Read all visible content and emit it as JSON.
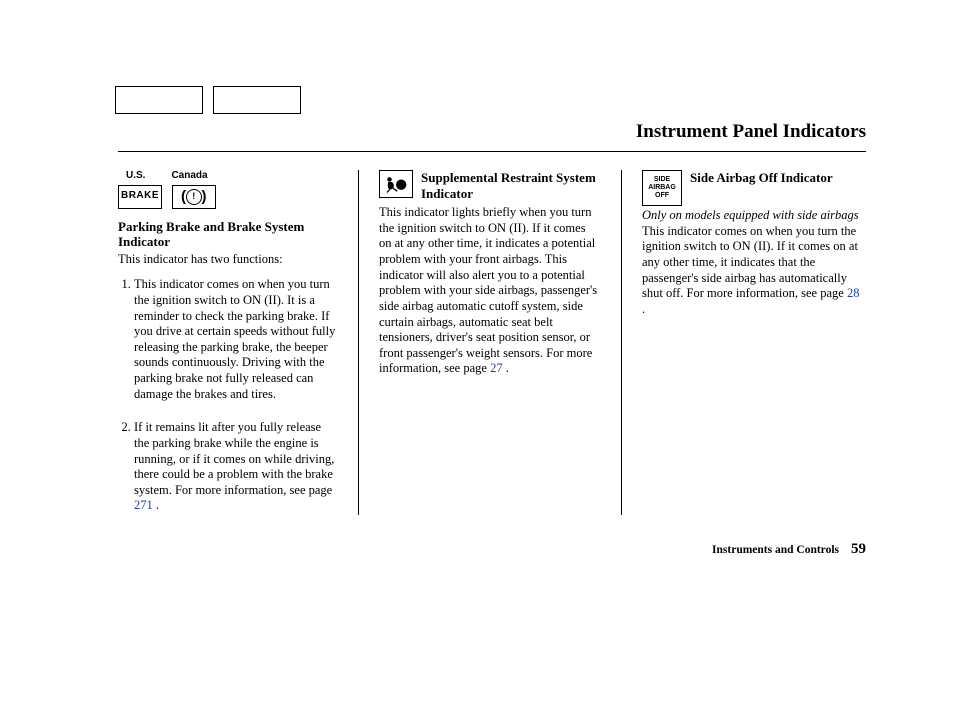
{
  "header": {
    "title": "Instrument Panel Indicators"
  },
  "footer": {
    "section": "Instruments and Controls",
    "page": "59"
  },
  "col1": {
    "labels": {
      "us": "U.S.",
      "canada": "Canada"
    },
    "icon_brake": "BRAKE",
    "title": "Parking Brake and Brake System Indicator",
    "intro": "This indicator has two functions:",
    "item1": "This indicator comes on when you turn the ignition switch to ON (II). It is a reminder to check the parking brake. If you drive at certain speeds without fully releasing the parking brake, the beeper sounds continuously. Driving with the parking brake not fully released can damage the brakes and tires.",
    "item2_a": "If it remains lit after you fully release the parking brake while the engine is running, or if it comes on while driving, there could be a problem with the brake system. For more information, see page ",
    "item2_link": "271",
    "item2_b": " ."
  },
  "col2": {
    "title": "Supplemental Restraint System Indicator",
    "body_a": "This indicator lights briefly when you turn the ignition switch to ON (II). If it comes on at any other time, it indicates a potential problem with your front airbags. This indicator will also alert you to a potential problem with your side airbags, passenger's side airbag automatic cutoff system, side curtain airbags, automatic seat belt tensioners, driver's seat position sensor, or front passenger's weight sensors. For more information, see page ",
    "body_link": "27",
    "body_b": " ."
  },
  "col3": {
    "title": "Side Airbag Off Indicator",
    "icon_text": "SIDE\nAIRBAG\nOFF",
    "note": "Only on models equipped with side airbags",
    "body_a": "This indicator comes on when you turn the ignition switch to ON (II). If it comes on at any other time, it indicates that the passenger's side airbag has automatically shut off. For more information, see page ",
    "body_link": "28",
    "body_b": " ."
  }
}
